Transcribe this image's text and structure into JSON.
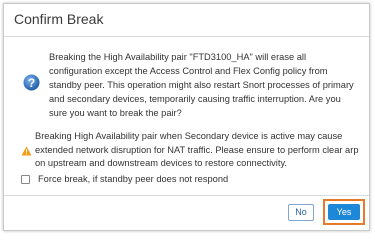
{
  "dialog": {
    "title": "Confirm Break",
    "message": "Breaking the High Availability pair \"FTD3100_HA\" will erase all configuration except the Access Control and Flex Config policy from standby peer. This operation might also restart Snort processes of primary and secondary devices, temporarily causing traffic interruption. Are you sure you want to break the pair?",
    "warning": "Breaking High Availability pair when Secondary device is active may cause extended network disruption for NAT traffic. Please ensure to perform clear arp on upstream and downstream devices to restore connectivity.",
    "checkbox_label": "Force break, if standby peer does not respond",
    "no_label": "No",
    "yes_label": "Yes"
  },
  "icons": {
    "question": "question-icon",
    "warning": "warning-icon"
  },
  "colors": {
    "accent": "#1e88d8",
    "highlight": "#e8782a",
    "warning": "#f39c12"
  }
}
